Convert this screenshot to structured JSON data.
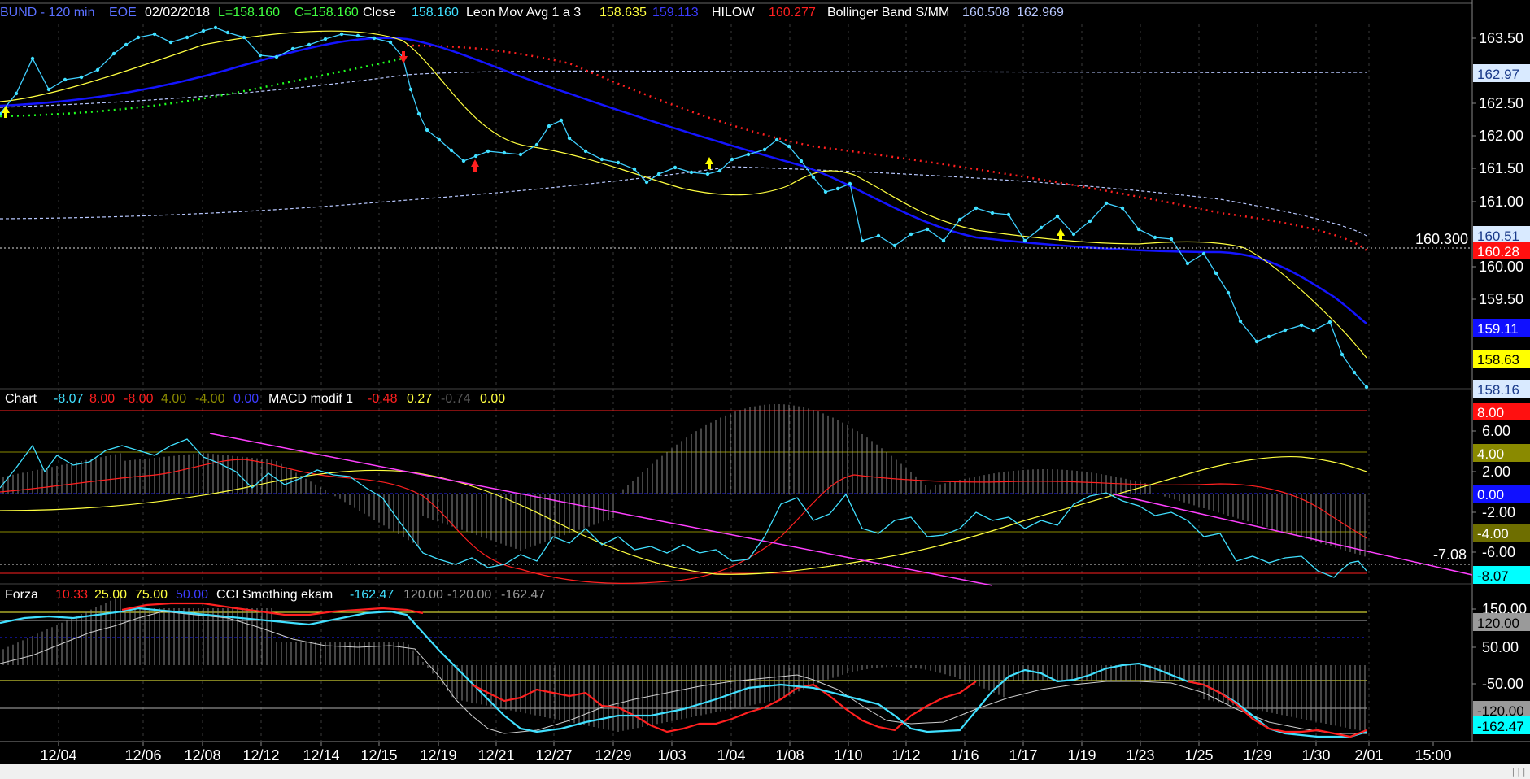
{
  "header": {
    "instrument": "BUND - 120 min",
    "exchange": "EOE",
    "date": "02/02/2018",
    "low": "L=158.160",
    "close": "C=158.160",
    "field": "Close",
    "field_value": "158.160",
    "mov_avg_name": "Leon Mov Avg 1 a 3",
    "mov_avg_v1": "158.635",
    "mov_avg_v2": "159.113",
    "hilow_name": "HILOW",
    "hilow_value": "160.277",
    "boll_name": "Bollinger Band S/MM",
    "boll_v1": "160.508",
    "boll_v2": "162.969"
  },
  "macd_header": {
    "chart_label": "Chart",
    "v1": "-8.07",
    "v2": "8.00",
    "v3": "-8.00",
    "v4": "4.00",
    "v5": "-4.00",
    "v6": "0.00",
    "macd_name": "MACD modif 1",
    "m1": "-0.48",
    "m2": "0.27",
    "m3": "-0.74",
    "m4": "0.00"
  },
  "cci_header": {
    "forza_label": "Forza",
    "f1": "10.33",
    "f2": "25.00",
    "f3": "75.00",
    "f4": "50.00",
    "cci_name": "CCI Smothing ekam",
    "c1": "-162.47",
    "c2": "120.00",
    "c3": "-120.00",
    "c4": "-162.47"
  },
  "price_axis": {
    "ticks": [
      "163.50",
      "162.50",
      "162.00",
      "161.50",
      "161.00",
      "160.00",
      "159.50"
    ],
    "boxes": [
      {
        "label": "162.97",
        "bg": "#d9eaff",
        "fg": "#1a3a8a"
      },
      {
        "label": "160.51",
        "bg": "#d9eaff",
        "fg": "#1a3a8a"
      },
      {
        "label": "160.28",
        "bg": "#ff1010",
        "fg": "#ffffff"
      },
      {
        "label": "159.11",
        "bg": "#1010ff",
        "fg": "#ffffff"
      },
      {
        "label": "158.63",
        "bg": "#ffff00",
        "fg": "#000000"
      },
      {
        "label": "158.16",
        "bg": "#d9eaff",
        "fg": "#1a3a8a"
      }
    ],
    "cursor_value": "160.300"
  },
  "macd_axis": {
    "ticks": [
      "6.00",
      "2.00",
      "-2.00",
      "-6.00"
    ],
    "boxes": [
      {
        "label": "8.00",
        "bg": "#ff1010",
        "fg": "#ffffff"
      },
      {
        "label": "4.00",
        "bg": "#8a8a00",
        "fg": "#ffffff"
      },
      {
        "label": "0.00",
        "bg": "#1010ff",
        "fg": "#ffffff"
      },
      {
        "label": "-4.00",
        "bg": "#6e6e00",
        "fg": "#ffffff"
      },
      {
        "label": "-8.07",
        "bg": "#00ffff",
        "fg": "#000000"
      }
    ],
    "cursor_value": "-7.08"
  },
  "cci_axis": {
    "ticks": [
      "150.00",
      "50.00",
      "-50.00"
    ],
    "boxes": [
      {
        "label": "120.00",
        "bg": "#9a9a9a",
        "fg": "#000000"
      },
      {
        "label": "-120.00",
        "bg": "#9a9a9a",
        "fg": "#000000"
      },
      {
        "label": "-162.47",
        "bg": "#00ffff",
        "fg": "#000000"
      }
    ]
  },
  "time_axis": {
    "labels": [
      "12/04",
      "12/06",
      "12/08",
      "12/12",
      "12/14",
      "12/15",
      "12/19",
      "12/21",
      "12/27",
      "12/29",
      "1/03",
      "1/04",
      "1/08",
      "1/10",
      "1/12",
      "1/16",
      "1/17",
      "1/19",
      "1/23",
      "1/25",
      "1/29",
      "1/30",
      "2/01",
      "15:00"
    ]
  },
  "colors": {
    "close_line": "#00d8ff",
    "fast_ma": "#ffff40",
    "slow_ma": "#1010ff",
    "hilow": "#ff2020",
    "hilow_green": "#20ff20",
    "bollinger": "#b8c8ff",
    "macd_signal": "#ff2020",
    "macd_main": "#40e0ff",
    "macd_slow": "#ffff40",
    "trendline": "#ff40ff",
    "cci": "#40e0ff",
    "cci_red": "#ff2020"
  },
  "chart_data": [
    {
      "type": "line",
      "title": "BUND - 120 min",
      "ylim": [
        158.0,
        163.75
      ],
      "x_ticks": [
        "12/04",
        "12/06",
        "12/08",
        "12/12",
        "12/14",
        "12/15",
        "12/19",
        "12/21",
        "12/27",
        "12/29",
        "1/03",
        "1/04",
        "1/08",
        "1/10",
        "1/12",
        "1/16",
        "1/17",
        "1/19",
        "1/23",
        "1/25",
        "1/29",
        "1/30",
        "2/01"
      ],
      "series": [
        {
          "name": "Close",
          "values": [
            162.4,
            162.6,
            163.1,
            162.9,
            163.4,
            163.6,
            163.5,
            163.2,
            163.3,
            163.5,
            162.3,
            161.6,
            161.7,
            161.7,
            161.8,
            162.1,
            161.6,
            161.4,
            161.7,
            161.6,
            161.9,
            161.8,
            161.1,
            160.9,
            160.8,
            160.6,
            161.0,
            160.9,
            160.4,
            160.7,
            160.9,
            160.6,
            159.7,
            159.8,
            159.3,
            158.7,
            158.16
          ]
        },
        {
          "name": "Leon Mov Avg 1 a 3",
          "values": [
            162.5,
            162.6,
            162.9,
            163.3,
            163.5,
            163.6,
            163.6,
            163.5,
            163.6,
            163.6,
            162.8,
            162.0,
            161.7,
            161.5,
            161.3,
            161.2,
            161.2,
            161.5,
            161.5,
            161.3,
            160.8,
            160.6,
            160.5,
            160.4,
            160.4,
            160.5,
            160.4,
            160.3,
            159.5,
            159.0,
            158.635
          ]
        },
        {
          "name": "HILOW",
          "values": [
            160.277
          ]
        },
        {
          "name": "Bollinger Band S/MM",
          "values": [
            160.508,
            162.969
          ]
        }
      ]
    },
    {
      "type": "line",
      "title": "MACD modif 1",
      "ylim": [
        -8.0,
        8.0
      ],
      "x_ticks": [
        "12/04",
        "12/06",
        "12/08",
        "12/12",
        "12/14",
        "12/15",
        "12/19",
        "12/21",
        "12/27",
        "12/29",
        "1/03",
        "1/04",
        "1/08",
        "1/10",
        "1/12",
        "1/16",
        "1/17",
        "1/19",
        "1/23",
        "1/25",
        "1/29",
        "1/30",
        "2/01"
      ],
      "series": [
        {
          "name": "MACD modif 1",
          "values": [
            1.0,
            3.5,
            4.0,
            4.5,
            5.0,
            4.0,
            2.5,
            1.5,
            3.0,
            1.0,
            -4.0,
            -6.5,
            -5.5,
            -3.0,
            -4.5,
            -4.0,
            -6.5,
            -2.5,
            0.0,
            -1.5,
            0.0,
            -6.5,
            -4.0,
            -3.0,
            -2.0,
            -1.5,
            0.0,
            -1.5,
            -3.5,
            -6.5,
            -7.0,
            -8.07
          ]
        }
      ]
    },
    {
      "type": "line",
      "title": "CCI Smothing ekam",
      "ylim": [
        -170,
        160
      ],
      "x_ticks": [
        "12/04",
        "12/06",
        "12/08",
        "12/12",
        "12/14",
        "12/15",
        "12/19",
        "12/21",
        "12/27",
        "12/29",
        "1/03",
        "1/04",
        "1/08",
        "1/10",
        "1/12",
        "1/16",
        "1/17",
        "1/19",
        "1/23",
        "1/25",
        "1/29",
        "1/30",
        "2/01"
      ],
      "series": [
        {
          "name": "CCI Smothing ekam",
          "values": [
            110,
            115,
            120,
            135,
            140,
            138,
            120,
            122,
            125,
            0,
            -100,
            -160,
            -150,
            -140,
            -90,
            -120,
            -160,
            -90,
            -30,
            -100,
            -155,
            -150,
            -70,
            -40,
            -40,
            -30,
            -40,
            -50,
            -90,
            -150,
            -162.47
          ]
        }
      ]
    }
  ]
}
